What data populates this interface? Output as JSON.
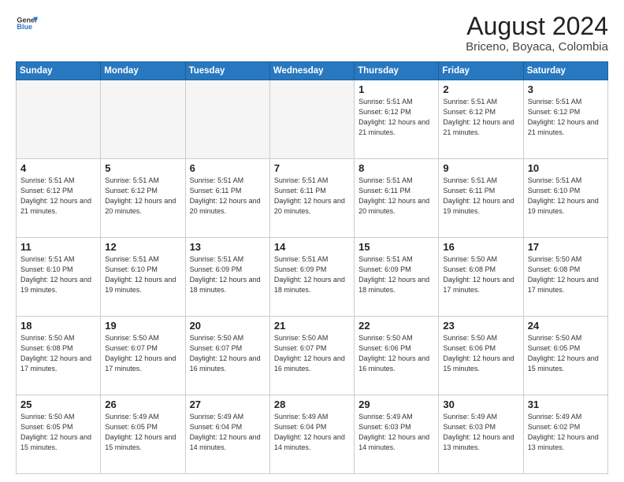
{
  "header": {
    "logo_line1": "General",
    "logo_line2": "Blue",
    "title": "August 2024",
    "subtitle": "Briceno, Boyaca, Colombia"
  },
  "weekdays": [
    "Sunday",
    "Monday",
    "Tuesday",
    "Wednesday",
    "Thursday",
    "Friday",
    "Saturday"
  ],
  "weeks": [
    [
      {
        "day": "",
        "info": ""
      },
      {
        "day": "",
        "info": ""
      },
      {
        "day": "",
        "info": ""
      },
      {
        "day": "",
        "info": ""
      },
      {
        "day": "1",
        "info": "Sunrise: 5:51 AM\nSunset: 6:12 PM\nDaylight: 12 hours\nand 21 minutes."
      },
      {
        "day": "2",
        "info": "Sunrise: 5:51 AM\nSunset: 6:12 PM\nDaylight: 12 hours\nand 21 minutes."
      },
      {
        "day": "3",
        "info": "Sunrise: 5:51 AM\nSunset: 6:12 PM\nDaylight: 12 hours\nand 21 minutes."
      }
    ],
    [
      {
        "day": "4",
        "info": "Sunrise: 5:51 AM\nSunset: 6:12 PM\nDaylight: 12 hours\nand 21 minutes."
      },
      {
        "day": "5",
        "info": "Sunrise: 5:51 AM\nSunset: 6:12 PM\nDaylight: 12 hours\nand 20 minutes."
      },
      {
        "day": "6",
        "info": "Sunrise: 5:51 AM\nSunset: 6:11 PM\nDaylight: 12 hours\nand 20 minutes."
      },
      {
        "day": "7",
        "info": "Sunrise: 5:51 AM\nSunset: 6:11 PM\nDaylight: 12 hours\nand 20 minutes."
      },
      {
        "day": "8",
        "info": "Sunrise: 5:51 AM\nSunset: 6:11 PM\nDaylight: 12 hours\nand 20 minutes."
      },
      {
        "day": "9",
        "info": "Sunrise: 5:51 AM\nSunset: 6:11 PM\nDaylight: 12 hours\nand 19 minutes."
      },
      {
        "day": "10",
        "info": "Sunrise: 5:51 AM\nSunset: 6:10 PM\nDaylight: 12 hours\nand 19 minutes."
      }
    ],
    [
      {
        "day": "11",
        "info": "Sunrise: 5:51 AM\nSunset: 6:10 PM\nDaylight: 12 hours\nand 19 minutes."
      },
      {
        "day": "12",
        "info": "Sunrise: 5:51 AM\nSunset: 6:10 PM\nDaylight: 12 hours\nand 19 minutes."
      },
      {
        "day": "13",
        "info": "Sunrise: 5:51 AM\nSunset: 6:09 PM\nDaylight: 12 hours\nand 18 minutes."
      },
      {
        "day": "14",
        "info": "Sunrise: 5:51 AM\nSunset: 6:09 PM\nDaylight: 12 hours\nand 18 minutes."
      },
      {
        "day": "15",
        "info": "Sunrise: 5:51 AM\nSunset: 6:09 PM\nDaylight: 12 hours\nand 18 minutes."
      },
      {
        "day": "16",
        "info": "Sunrise: 5:50 AM\nSunset: 6:08 PM\nDaylight: 12 hours\nand 17 minutes."
      },
      {
        "day": "17",
        "info": "Sunrise: 5:50 AM\nSunset: 6:08 PM\nDaylight: 12 hours\nand 17 minutes."
      }
    ],
    [
      {
        "day": "18",
        "info": "Sunrise: 5:50 AM\nSunset: 6:08 PM\nDaylight: 12 hours\nand 17 minutes."
      },
      {
        "day": "19",
        "info": "Sunrise: 5:50 AM\nSunset: 6:07 PM\nDaylight: 12 hours\nand 17 minutes."
      },
      {
        "day": "20",
        "info": "Sunrise: 5:50 AM\nSunset: 6:07 PM\nDaylight: 12 hours\nand 16 minutes."
      },
      {
        "day": "21",
        "info": "Sunrise: 5:50 AM\nSunset: 6:07 PM\nDaylight: 12 hours\nand 16 minutes."
      },
      {
        "day": "22",
        "info": "Sunrise: 5:50 AM\nSunset: 6:06 PM\nDaylight: 12 hours\nand 16 minutes."
      },
      {
        "day": "23",
        "info": "Sunrise: 5:50 AM\nSunset: 6:06 PM\nDaylight: 12 hours\nand 15 minutes."
      },
      {
        "day": "24",
        "info": "Sunrise: 5:50 AM\nSunset: 6:05 PM\nDaylight: 12 hours\nand 15 minutes."
      }
    ],
    [
      {
        "day": "25",
        "info": "Sunrise: 5:50 AM\nSunset: 6:05 PM\nDaylight: 12 hours\nand 15 minutes."
      },
      {
        "day": "26",
        "info": "Sunrise: 5:49 AM\nSunset: 6:05 PM\nDaylight: 12 hours\nand 15 minutes."
      },
      {
        "day": "27",
        "info": "Sunrise: 5:49 AM\nSunset: 6:04 PM\nDaylight: 12 hours\nand 14 minutes."
      },
      {
        "day": "28",
        "info": "Sunrise: 5:49 AM\nSunset: 6:04 PM\nDaylight: 12 hours\nand 14 minutes."
      },
      {
        "day": "29",
        "info": "Sunrise: 5:49 AM\nSunset: 6:03 PM\nDaylight: 12 hours\nand 14 minutes."
      },
      {
        "day": "30",
        "info": "Sunrise: 5:49 AM\nSunset: 6:03 PM\nDaylight: 12 hours\nand 13 minutes."
      },
      {
        "day": "31",
        "info": "Sunrise: 5:49 AM\nSunset: 6:02 PM\nDaylight: 12 hours\nand 13 minutes."
      }
    ]
  ]
}
